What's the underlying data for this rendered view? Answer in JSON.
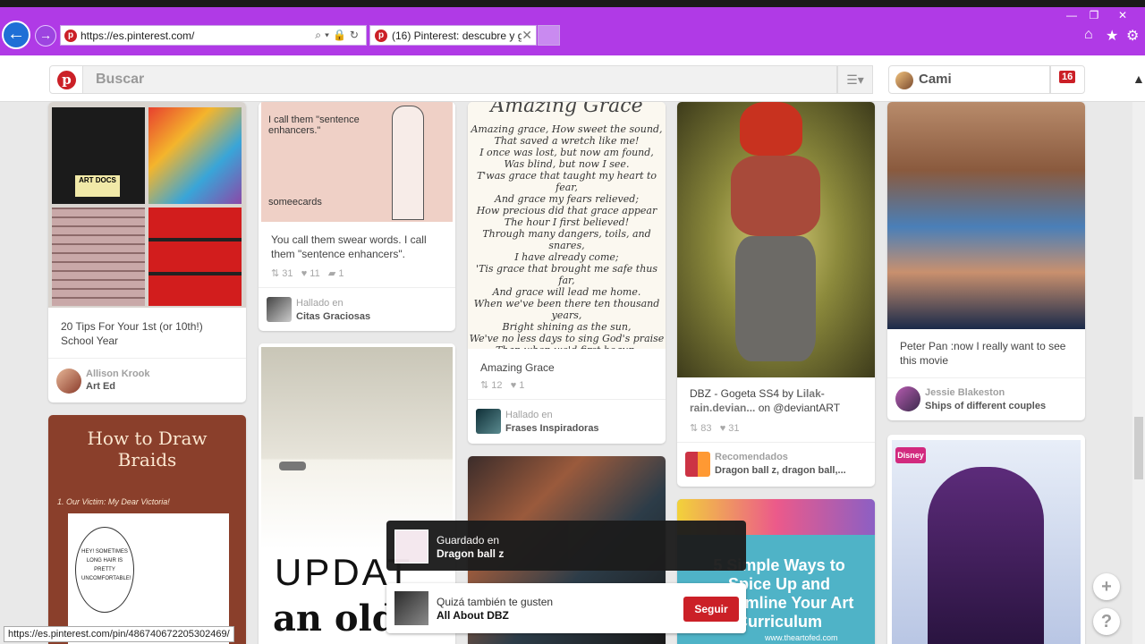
{
  "browser": {
    "url": "https://es.pinterest.com/",
    "tab_title": "(16) Pinterest: descubre y g...",
    "status_url": "https://es.pinterest.com/pin/486740672205302469/"
  },
  "header": {
    "search_placeholder": "Buscar",
    "user_name": "Cami",
    "notification_count": "16"
  },
  "pins": [
    {
      "description": "20 Tips For Your 1st (or 10th!) School Year",
      "user": "Allison Krook",
      "board": "Art Ed",
      "image_text": "ART DOCS"
    },
    {
      "description": "You call them swear words. I call them \"sentence enhancers\".",
      "repins": "31",
      "likes": "11",
      "comments": "1",
      "via_label": "Hallado en",
      "board": "Citas Graciosas",
      "image_quote": "I call them \"sentence enhancers.\"",
      "image_brand": "someecards"
    },
    {
      "description": "Amazing Grace",
      "repins": "12",
      "likes": "1",
      "via_label": "Hallado en",
      "board": "Frases Inspiradoras",
      "image_title": "Amazing Grace",
      "poem_lines": [
        "Amazing grace, How sweet the sound,",
        "That saved a wretch like me!",
        "I once was lost, but now am found,",
        "Was blind, but now I see.",
        "T'was grace that taught my heart to fear,",
        "And grace my fears relieved;",
        "How precious did that grace appear",
        "The hour I first believed!",
        "Through many dangers, toils, and snares,",
        "I have already come;",
        "'Tis grace that brought me safe thus far,",
        "And grace will lead me home.",
        "When we've been there ten thousand years,",
        "Bright shining as the sun,",
        "We've no less days to sing God's praise",
        "Than when we'd first begun."
      ]
    },
    {
      "description_a": "DBZ - Gogeta SS4 by ",
      "description_link": "Lilak-rain.devian...",
      "description_b": " on @deviantART",
      "repins": "83",
      "likes": "31",
      "via_label": "Recomendados",
      "board": "Dragon ball z, dragon ball,..."
    },
    {
      "description": "Peter Pan :now I really want to see this movie",
      "user": "Jessie Blakeston",
      "board": "Ships of different couples"
    },
    {
      "image_title": "How to Draw Braids",
      "image_sub": "1. Our Victim: My Dear Victoria!",
      "bubble": "HEY! SOMETIMES LONG HAIR IS PRETTY UNCOMFORTABLE!"
    },
    {
      "image_text_1": "UPDAT",
      "image_text_2": "an old"
    },
    {
      "image_text": "5 Simple Ways to Spice Up and Streamline Your Art Curriculum",
      "image_site": "www.theartofed.com"
    },
    {
      "image_brand": "Disney"
    }
  ],
  "toast_saved": {
    "line1": "Guardado en",
    "line2": "Dragon ball z"
  },
  "toast_suggest": {
    "line1": "Quizá también te gusten",
    "line2": "All About DBZ",
    "button": "Seguir"
  },
  "colors": {
    "chrome": "#b03ae6",
    "pinterest_red": "#cb2027"
  }
}
